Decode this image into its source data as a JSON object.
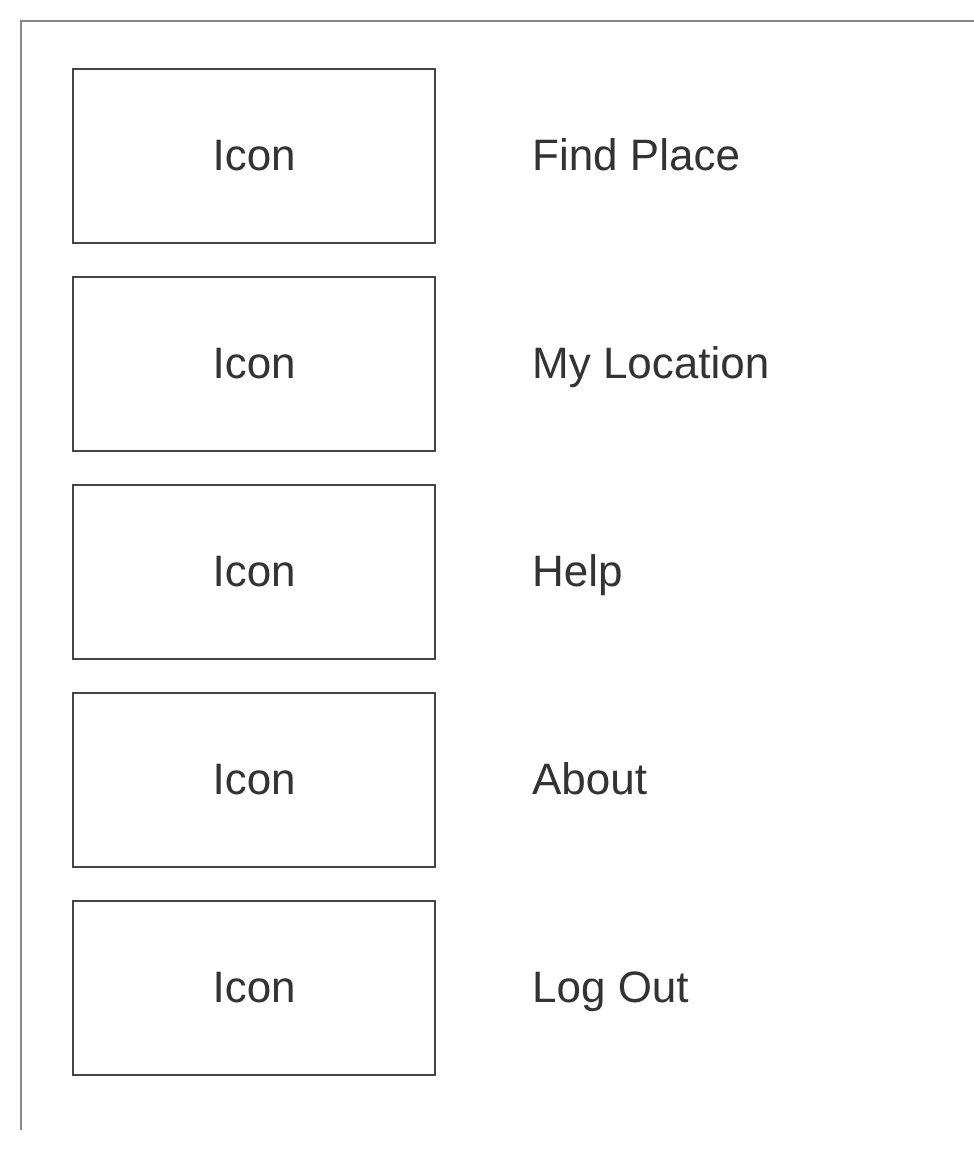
{
  "menu_items": [
    {
      "icon": "Icon",
      "label": "Find Place"
    },
    {
      "icon": "Icon",
      "label": "My Location"
    },
    {
      "icon": "Icon",
      "label": "Help"
    },
    {
      "icon": "Icon",
      "label": "About"
    },
    {
      "icon": "Icon",
      "label": "Log Out"
    }
  ]
}
